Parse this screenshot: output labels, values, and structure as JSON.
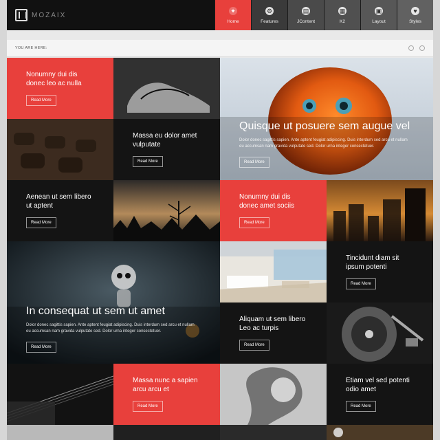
{
  "brand": {
    "name": "MOZAIX"
  },
  "nav": {
    "items": [
      {
        "label": "Home",
        "icon": "home-icon",
        "active": true
      },
      {
        "label": "Features",
        "icon": "features-icon",
        "active": false
      },
      {
        "label": "JContent",
        "icon": "jcontent-icon",
        "active": false
      },
      {
        "label": "K2",
        "icon": "k2-icon",
        "active": false
      },
      {
        "label": "Layout",
        "icon": "layout-icon",
        "active": false
      },
      {
        "label": "Styles",
        "icon": "styles-icon",
        "active": false
      }
    ]
  },
  "breadcrumb": {
    "label": "YOU ARE HERE:"
  },
  "tiles": {
    "t1": {
      "title": "Nonumny dui dis donec leo ac nulla",
      "button": "Read More"
    },
    "t2": {
      "title": "Massa eu dolor amet vulputate",
      "button": "Read More"
    },
    "t3": {
      "title": "Aenean ut sem libero ut aptent",
      "button": "Read More"
    },
    "hero": {
      "title": "Quisque ut posuere sem augue vel",
      "desc": "Dolor donec sagittis sapien. Ante aptent feugiat adipiscing. Duis interdum sed arcu et nullam eu accumsan nam gravida vulputate sed. Dolor urna integer consectetuer.",
      "button": "Read More"
    },
    "t4": {
      "title": "Nonumny dui dis donec amet sociis",
      "button": "Read More"
    },
    "t5": {
      "title": "Tincidunt diam sit ipsum potenti",
      "button": "Read More"
    },
    "t6": {
      "title": "Aliquam ut sem libero Leo ac turpis",
      "button": "Read More"
    },
    "hero2": {
      "title": "In consequat ut sem ut amet",
      "desc": "Dolor donec sagittis sapien. Ante aptent feugiat adipiscing. Duis interdum sed arcu et nullam eu accumsan nam gravida vulputate sed. Dolor urna integer consectetuer.",
      "button": "Read More"
    },
    "t7": {
      "title": "Massa nunc a sapien arcu arcu et",
      "button": "Read More"
    },
    "t8": {
      "title": "Etiam vel sed potenti odio amet",
      "button": "Read More"
    }
  },
  "colors": {
    "accent": "#e8403c",
    "dark": "#141414"
  }
}
